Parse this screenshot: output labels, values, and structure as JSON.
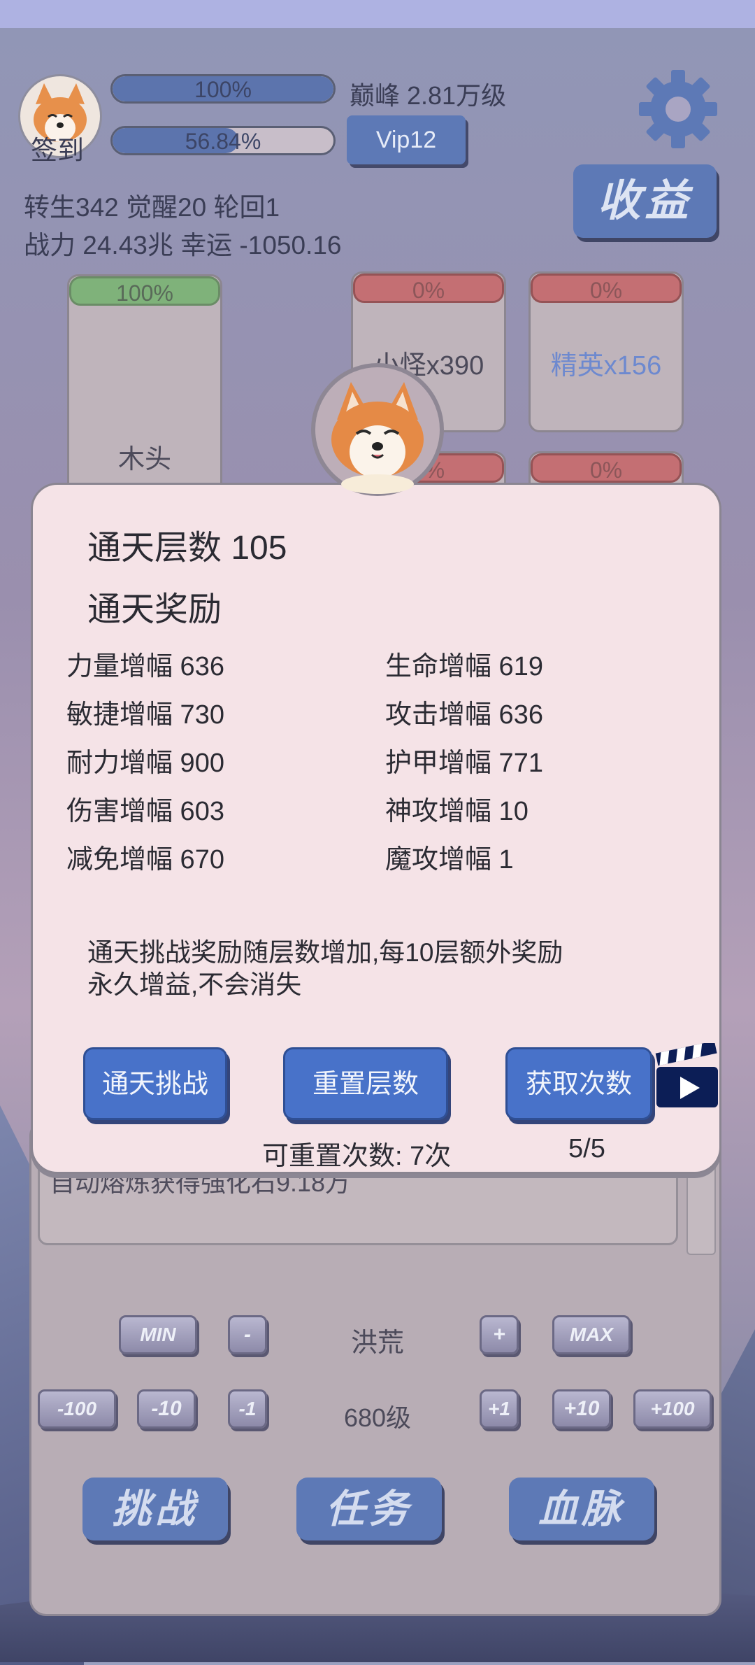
{
  "header": {
    "checkin_label": "签到",
    "hp_bar": {
      "percent_text": "100%",
      "fill": 1.0
    },
    "exp_bar": {
      "percent_text": "56.84%",
      "fill": 0.5684
    },
    "level_text": "巅峰 2.81万级",
    "vip_label": "Vip12",
    "income_label": "收益",
    "stats_line1": "转生342 觉醒20 轮回1",
    "stats_line2": "战力 24.43兆  幸运 -1050.16"
  },
  "cards": {
    "wood": {
      "percent": "100%",
      "label": "木头"
    },
    "minion": {
      "percent": "0%",
      "label": "小怪x390"
    },
    "elite": {
      "percent": "0%",
      "label": "精英x156"
    },
    "row2_left_percent": "0%",
    "row2_right_percent": "0%"
  },
  "modal": {
    "floor_title": "通天层数 105",
    "reward_title": "通天奖励",
    "stats": [
      {
        "left": "力量增幅 636",
        "right": "生命增幅 619"
      },
      {
        "left": "敏捷增幅 730",
        "right": "攻击增幅 636"
      },
      {
        "left": "耐力增幅 900",
        "right": "护甲增幅 771"
      },
      {
        "left": "伤害增幅 603",
        "right": "神攻增幅 10"
      },
      {
        "left": "减免增幅 670",
        "right": "魔攻增幅 1"
      }
    ],
    "desc_line1": "通天挑战奖励随层数增加,每10层额外奖励",
    "desc_line2": "永久增益,不会消失",
    "btn_challenge": "通天挑战",
    "btn_reset": "重置层数",
    "btn_get": "获取次数",
    "reset_count": "可重置次数: 7次",
    "get_count": "5/5"
  },
  "log": {
    "text": "自动熔炼获得强化石9.18万"
  },
  "controls": {
    "min": "MIN",
    "minus": "-",
    "zone": "洪荒",
    "plus": "+",
    "max": "MAX",
    "m100": "-100",
    "m10": "-10",
    "m1": "-1",
    "level": "680级",
    "p1": "+1",
    "p10": "+10",
    "p100": "+100"
  },
  "bottom_nav": {
    "challenge": "挑战",
    "task": "任务",
    "bloodline": "血脉"
  },
  "colors": {
    "accent_blue": "#4872c9",
    "modal_bg": "#f5e3e7",
    "elite_text": "#6d89cf"
  }
}
